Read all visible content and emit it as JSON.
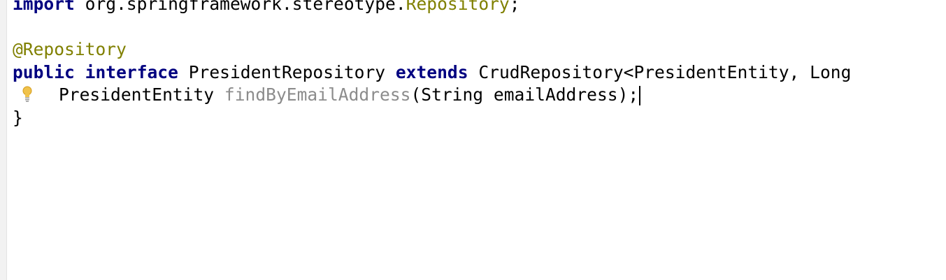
{
  "editor": {
    "import_line": {
      "keyword": "import",
      "package": " org.springframework.stereotype.",
      "class_name": "Repository",
      "terminator": ";"
    },
    "annotation": "@Repository",
    "declaration": {
      "modifier": "public",
      "type_keyword": "interface",
      "name": "PresidentRepository",
      "extends_keyword": "extends",
      "supertype": "CrudRepository<PresidentEntity, Long"
    },
    "method": {
      "return_type": "PresidentEntity",
      "name": "findByEmailAddress",
      "params": "(String emailAddress);"
    },
    "closing_brace": "}",
    "gutter_icon": "lightbulb-icon",
    "colors": {
      "keyword": "#000080",
      "annotation": "#808000",
      "unused_method": "#8c8c8c",
      "text": "#000000"
    }
  }
}
